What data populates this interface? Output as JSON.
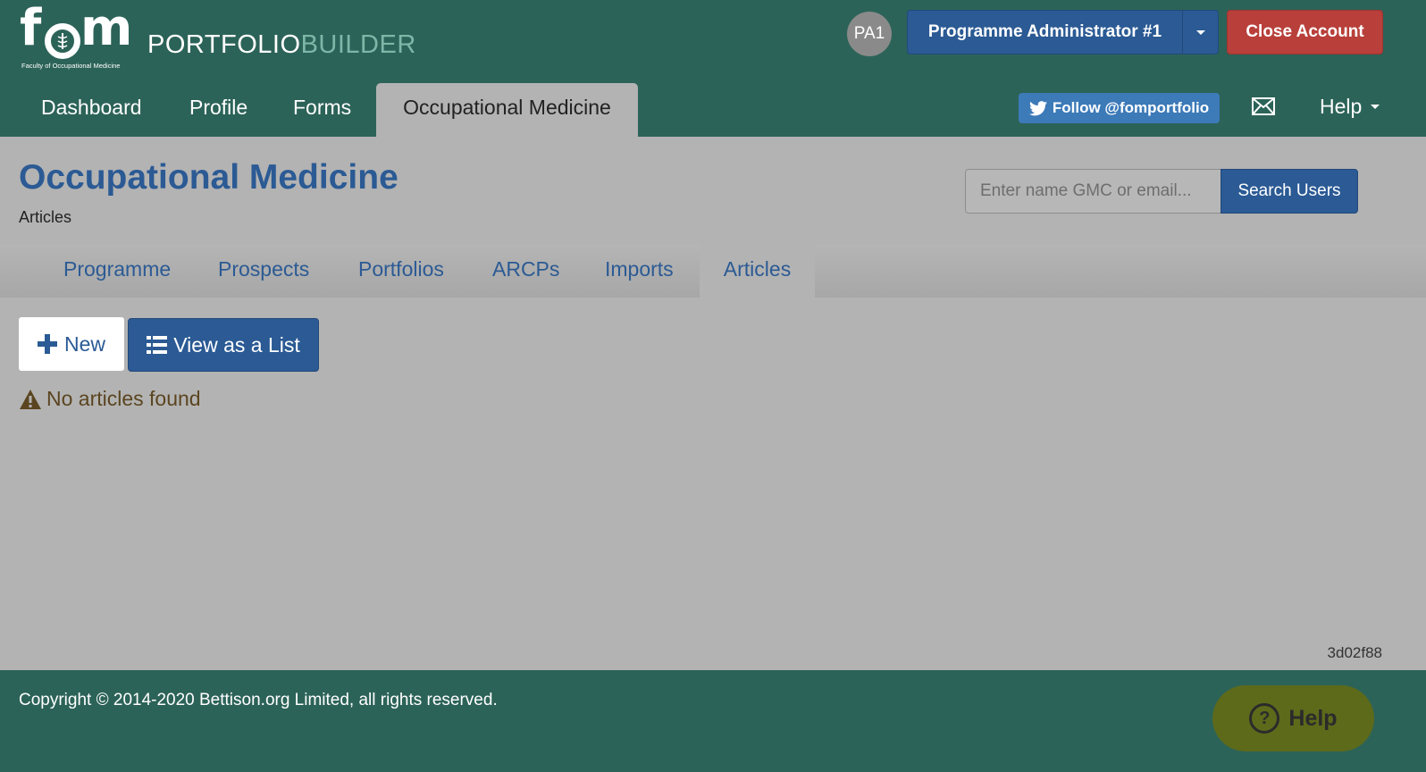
{
  "app": {
    "logo_text": "fom",
    "logo_caption": "Faculty of Occupational Medicine",
    "brand_primary": "PORTFOLIO",
    "brand_secondary": "BUILDER"
  },
  "header": {
    "avatar_initials": "PA1",
    "user_menu_label": "Programme Administrator #1",
    "close_account_label": "Close Account"
  },
  "nav": {
    "items": [
      {
        "label": "Dashboard"
      },
      {
        "label": "Profile"
      },
      {
        "label": "Forms"
      },
      {
        "label": "Occupational Medicine",
        "active": true
      }
    ],
    "follow_label": "Follow @fomportfolio",
    "help_label": "Help"
  },
  "page": {
    "title": "Occupational Medicine",
    "subtitle": "Articles"
  },
  "search": {
    "placeholder": "Enter name GMC or email...",
    "value": "",
    "button_label": "Search Users"
  },
  "subnav": {
    "items": [
      {
        "label": "Programme"
      },
      {
        "label": "Prospects"
      },
      {
        "label": "Portfolios"
      },
      {
        "label": "ARCPs"
      },
      {
        "label": "Imports"
      },
      {
        "label": "Articles",
        "active": true
      }
    ]
  },
  "actions": {
    "new_label": "New",
    "view_list_label": "View as a List"
  },
  "notice": {
    "message": "No articles found"
  },
  "version": "3d02f88",
  "footer": {
    "copyright": "Copyright © 2014-2020 Bettison.org Limited, all rights reserved.",
    "help_widget_label": "Help"
  },
  "icons": {
    "logo": "caduceus-icon",
    "twitter": "twitter-icon",
    "mail": "envelope-icon",
    "new": "plus-icon",
    "list": "list-icon",
    "warning": "warning-icon",
    "help": "question-circle-icon"
  },
  "colors": {
    "header_bg": "#2c6358",
    "primary": "#2b5a94",
    "danger": "#b83f3a",
    "page_bg": "#b3b3b3",
    "brand_accent": "#7fb6a8",
    "help_widget": "#5d6a1a",
    "warning_text": "#5b4520"
  }
}
